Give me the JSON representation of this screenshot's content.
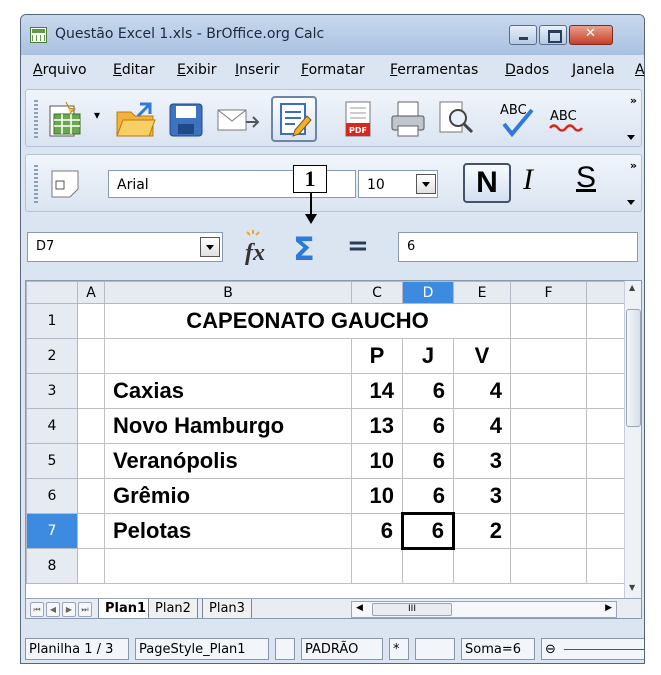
{
  "window": {
    "title": "Questão Excel 1.xls - BrOffice.org Calc"
  },
  "menu": [
    "Arquivo",
    "Editar",
    "Exibir",
    "Inserir",
    "Formatar",
    "Ferramentas",
    "Dados",
    "Janela",
    "A"
  ],
  "toolbar1": {
    "icons": [
      "new-document-icon",
      "open-folder-icon",
      "save-icon",
      "email-icon",
      "edit-mode-icon",
      "export-pdf-icon",
      "print-icon",
      "page-preview-icon",
      "spellcheck-icon",
      "autospellcheck-icon"
    ],
    "pdf_label": "PDF",
    "abc1": "ABC",
    "abc2": "ABC"
  },
  "toolbar2": {
    "font_name": "Arial",
    "font_size": "10",
    "bold": "N",
    "italic": "I",
    "underline": "S"
  },
  "formula": {
    "cell_ref": "D7",
    "function_wizard": "fx",
    "sum_symbol": "Σ",
    "equals": "=",
    "content": "6"
  },
  "annotation": {
    "label": "1"
  },
  "sheet": {
    "columns": [
      "",
      "A",
      "B",
      "C",
      "D",
      "E",
      "F"
    ],
    "selected_column": "D",
    "selected_row": "7",
    "rows": [
      {
        "num": "1",
        "b": "CAPEONATO GAUCHO",
        "c": "",
        "d": "",
        "e": ""
      },
      {
        "num": "2",
        "b": "",
        "c": "P",
        "d": "J",
        "e": "V"
      },
      {
        "num": "3",
        "b": "Caxias",
        "c": "14",
        "d": "6",
        "e": "4"
      },
      {
        "num": "4",
        "b": "Novo Hamburgo",
        "c": "13",
        "d": "6",
        "e": "4"
      },
      {
        "num": "5",
        "b": "Veranópolis",
        "c": "10",
        "d": "6",
        "e": "3"
      },
      {
        "num": "6",
        "b": "Grêmio",
        "c": "10",
        "d": "6",
        "e": "3"
      },
      {
        "num": "7",
        "b": "Pelotas",
        "c": "6",
        "d": "6",
        "e": "2"
      },
      {
        "num": "8",
        "b": "",
        "c": "",
        "d": "",
        "e": ""
      }
    ],
    "tabs": [
      "Plan1",
      "Plan2",
      "Plan3"
    ],
    "hscroll_label": "III"
  },
  "status": {
    "sheet": "Planilha 1 / 3",
    "style": "PageStyle_Plan1",
    "mode": "PADRÃO",
    "modified": "*",
    "sum": "Soma=6",
    "zoom_icon": "⊖"
  }
}
